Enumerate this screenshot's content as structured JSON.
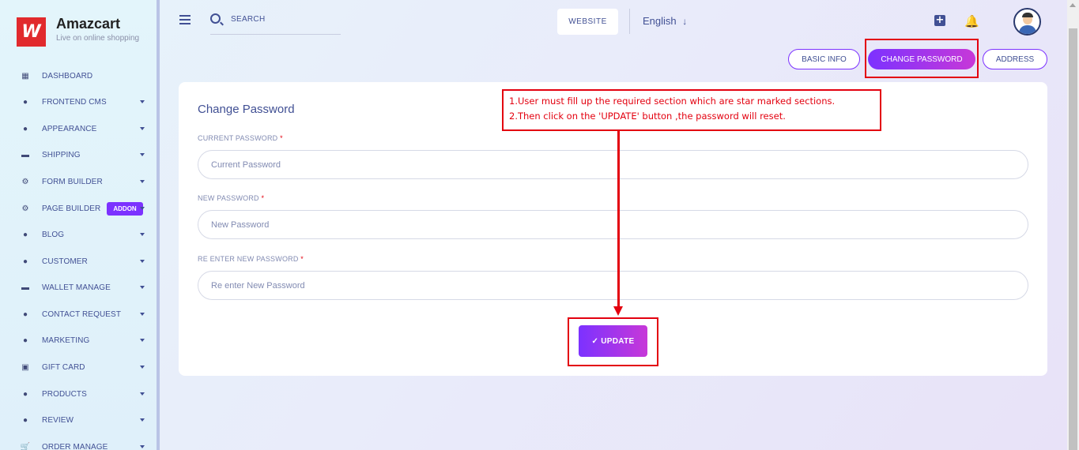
{
  "brand": {
    "logo_glyph": "W",
    "name": "Amazcart",
    "tagline": "Live on online shopping",
    "logo_color": "#e12a2d"
  },
  "sidebar": {
    "items": [
      {
        "label": "DASHBOARD",
        "icon": "grid-icon",
        "glyph": "▦",
        "caret": false
      },
      {
        "label": "FRONTEND CMS",
        "icon": "user-icon",
        "glyph": "●",
        "caret": true
      },
      {
        "label": "APPEARANCE",
        "icon": "user-icon",
        "glyph": "●",
        "caret": true
      },
      {
        "label": "SHIPPING",
        "icon": "money-icon",
        "glyph": "▬",
        "caret": true
      },
      {
        "label": "FORM BUILDER",
        "icon": "cogs-icon",
        "glyph": "⚙",
        "caret": true
      },
      {
        "label": "PAGE BUILDER",
        "icon": "cogs-icon",
        "glyph": "⚙",
        "caret": true,
        "badge": "ADDON"
      },
      {
        "label": "BLOG",
        "icon": "users-icon",
        "glyph": "●",
        "caret": true
      },
      {
        "label": "CUSTOMER",
        "icon": "users-icon",
        "glyph": "●",
        "caret": true
      },
      {
        "label": "WALLET MANAGE",
        "icon": "wallet-icon",
        "glyph": "▬",
        "caret": true
      },
      {
        "label": "CONTACT REQUEST",
        "icon": "user-icon",
        "glyph": "●",
        "caret": true
      },
      {
        "label": "MARKETING",
        "icon": "user-icon",
        "glyph": "●",
        "caret": true
      },
      {
        "label": "GIFT CARD",
        "icon": "gift-icon",
        "glyph": "▣",
        "caret": true
      },
      {
        "label": "PRODUCTS",
        "icon": "product-hunt-icon",
        "glyph": "●",
        "caret": true
      },
      {
        "label": "REVIEW",
        "icon": "user-icon",
        "glyph": "●",
        "caret": true
      },
      {
        "label": "ORDER MANAGE",
        "icon": "cart-icon",
        "glyph": "🛒",
        "caret": true
      }
    ]
  },
  "topbar": {
    "search_placeholder": "SEARCH",
    "website_label": "WEBSITE",
    "language": "English",
    "language_arrow": "↓",
    "plus_glyph": "+",
    "bell_glyph": "🔔"
  },
  "tabs": {
    "basic_info": "BASIC INFO",
    "change_password": "CHANGE PASSWORD",
    "address": "ADDRESS"
  },
  "form": {
    "title": "Change Password",
    "current": {
      "label": "CURRENT PASSWORD",
      "placeholder": "Current Password",
      "value": ""
    },
    "new": {
      "label": "NEW PASSWORD",
      "placeholder": "New Password",
      "value": ""
    },
    "reenter": {
      "label": "RE ENTER NEW PASSWORD",
      "placeholder": "Re enter New Password",
      "value": ""
    },
    "required_mark": "*",
    "update_label": "✓ UPDATE"
  },
  "annotation": {
    "line1": "1.User must fill up the required section which are star marked sections.",
    "line2": "2.Then click on the 'UPDATE' button ,the password will reset."
  },
  "colors": {
    "accent": "#7c32ff",
    "accent_end": "#c738d8",
    "text": "#415094",
    "annotation_red": "#e3000f"
  }
}
